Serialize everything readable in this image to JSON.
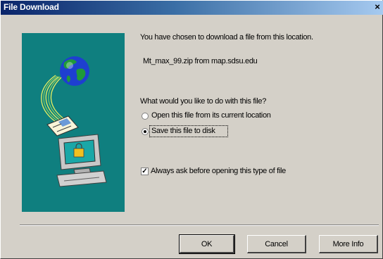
{
  "window": {
    "title": "File Download",
    "close_glyph": "×"
  },
  "message": {
    "intro": "You have chosen to download a file from this location.",
    "source": "Mt_max_99.zip from map.sdsu.edu",
    "question": "What would you like to do with this file?"
  },
  "options": {
    "open": {
      "label": "Open this file from its current location",
      "selected": false
    },
    "save": {
      "label": "Save this file to disk",
      "selected": true
    }
  },
  "always_ask": {
    "label": "Always ask before opening this type of file",
    "checked": true
  },
  "buttons": {
    "ok": "OK",
    "cancel": "Cancel",
    "more_info": "More Info"
  },
  "colors": {
    "title_gradient_start": "#0a246a",
    "title_gradient_end": "#a6caf0",
    "dialog_bg": "#d4d0c8",
    "art_bg": "#0f7f7f"
  },
  "icons": [
    "globe-icon",
    "document-icon",
    "computer-icon",
    "close-icon"
  ]
}
